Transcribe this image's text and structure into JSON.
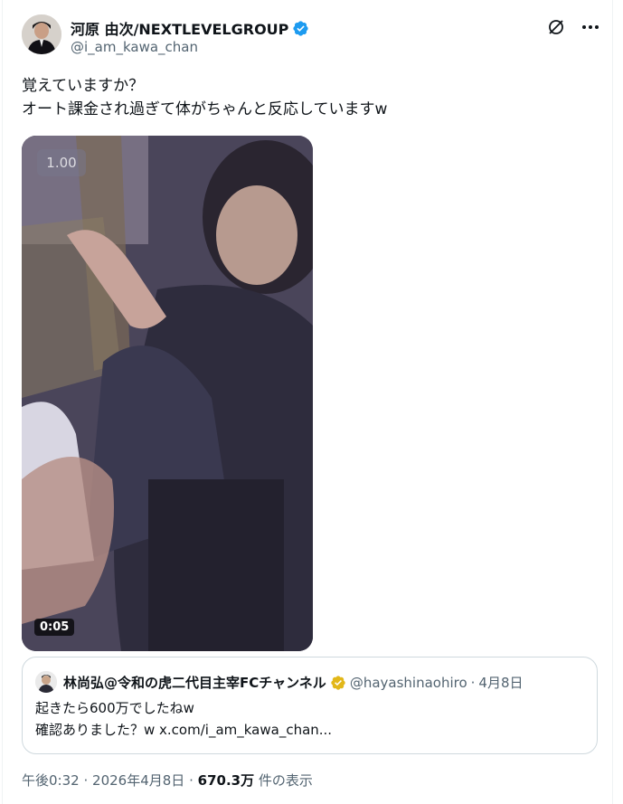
{
  "author": {
    "display_name": "河原 由次/NEXTLEVELGROUP",
    "handle": "@i_am_kawa_chan",
    "avatar_icon": "profile-photo",
    "verified_badge_color": "#1d9bf0"
  },
  "toolbar": {
    "grok_icon": "grok-icon",
    "more_icon": "more-icon"
  },
  "tweet": {
    "line1": "覚えていますか？",
    "line2": "オート課金され過ぎて体がちゃんと反応していますw"
  },
  "video": {
    "speed_label": "1.00",
    "duration": "0:05"
  },
  "quote": {
    "display_name": "林尚弘@令和の虎二代目主宰FCチャンネル",
    "handle": "@hayashinaohiro",
    "separator": "·",
    "date": "4月8日",
    "badge_color": "#e2b719",
    "text_line1": "起きたら600万でしたねw",
    "text_line2": "確認ありました？w x.com/i_am_kawa_chan..."
  },
  "footer": {
    "time": "午後0:32",
    "separator1": "·",
    "date": "2026年4月8日",
    "separator2": "·",
    "views": "670.3万",
    "views_suffix": "件の表示"
  }
}
